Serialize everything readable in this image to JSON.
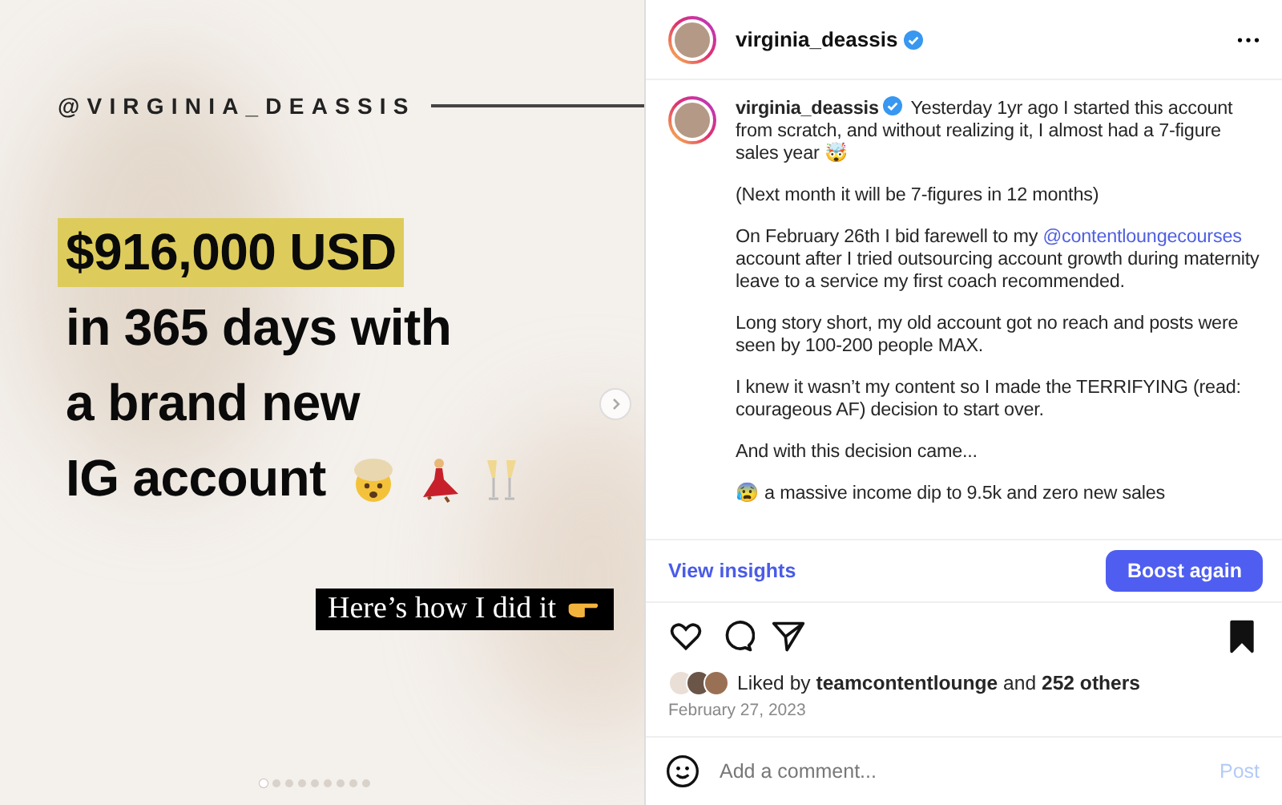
{
  "slide": {
    "handle": "@VIRGINIA_DEASSIS",
    "headline": [
      {
        "text": "$916,000 USD",
        "highlighted": true
      },
      {
        "text": "in 365 days with",
        "highlighted": false
      },
      {
        "text": "a brand new",
        "highlighted": false
      },
      {
        "text": "IG account",
        "highlighted": false
      }
    ],
    "cta": "Here’s how I did it",
    "dots": [
      {
        "selected": true
      },
      {
        "selected": false
      },
      {
        "selected": false
      },
      {
        "selected": false
      },
      {
        "selected": false
      },
      {
        "selected": false
      },
      {
        "selected": false
      },
      {
        "selected": false
      },
      {
        "selected": false
      }
    ]
  },
  "header": {
    "username": "virginia_deassis",
    "verified": true
  },
  "caption": {
    "username": "virginia_deassis",
    "verified": true,
    "paragraphs": [
      [
        {
          "kind": "text",
          "text": "Yesterday 1yr ago I started this account from scratch, and without realizing it, I almost had a 7-figure sales year 🤯"
        }
      ],
      [
        {
          "kind": "text",
          "text": "(Next month it will be 7-figures in 12 months)"
        }
      ],
      [
        {
          "kind": "text",
          "text": "On February 26th I bid farewell to my "
        },
        {
          "kind": "mention",
          "text": "@contentloungecourses"
        },
        {
          "kind": "text",
          "text": " account after I tried outsourcing account growth during maternity leave to a service my first coach recommended."
        }
      ],
      [
        {
          "kind": "text",
          "text": "Long story short, my old account got no reach and posts were seen by 100-200 people MAX."
        }
      ],
      [
        {
          "kind": "text",
          "text": "I knew it wasn’t my content so I made the TERRIFYING (read: courageous AF) decision to start over."
        }
      ],
      [
        {
          "kind": "text",
          "text": "And with this decision came..."
        }
      ],
      [
        {
          "kind": "text",
          "text": "😰 a massive income dip to 9.5k and zero new sales"
        }
      ]
    ]
  },
  "insights_link": "View insights",
  "boost_button": "Boost again",
  "actions": {
    "liked": false,
    "saved": true
  },
  "likes": "Liked by **teamcontentlounge** and **252 others**",
  "date": "February 27, 2023",
  "comment": {
    "placeholder": "Add a comment...",
    "post_label": "Post",
    "post_disabled": true
  }
}
